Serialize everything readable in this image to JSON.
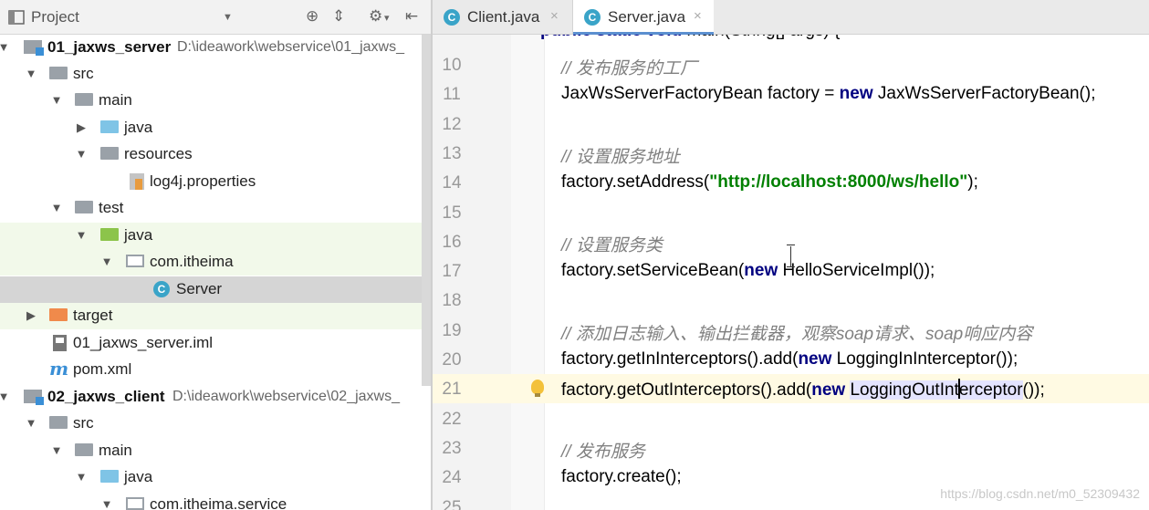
{
  "project_panel": {
    "title": "Project",
    "tree": [
      {
        "label": "01_jaxws_server",
        "path": "D:\\ideawork\\webservice\\01_jaxws_",
        "bold": true
      },
      {
        "label": "src"
      },
      {
        "label": "main"
      },
      {
        "label": "java"
      },
      {
        "label": "resources"
      },
      {
        "label": "log4j.properties"
      },
      {
        "label": "test"
      },
      {
        "label": "java"
      },
      {
        "label": "com.itheima"
      },
      {
        "label": "Server"
      },
      {
        "label": "target"
      },
      {
        "label": "01_jaxws_server.iml"
      },
      {
        "label": "pom.xml"
      },
      {
        "label": "02_jaxws_client",
        "path": "D:\\ideawork\\webservice\\02_jaxws_",
        "bold": true
      },
      {
        "label": "src"
      },
      {
        "label": "main"
      },
      {
        "label": "java"
      },
      {
        "label": "com.itheima.service"
      }
    ]
  },
  "editor": {
    "tabs": [
      {
        "label": "Client.java",
        "close": "×"
      },
      {
        "label": "Server.java",
        "close": "×"
      }
    ],
    "top_partial": "public static void main(String[] args) {",
    "lines": [
      {
        "num": "10",
        "text": "// 发布服务的工厂"
      },
      {
        "num": "11",
        "text": "JaxWsServerFactoryBean factory = new JaxWsServerFactoryBean();"
      },
      {
        "num": "12",
        "text": ""
      },
      {
        "num": "13",
        "text": "// 设置服务地址"
      },
      {
        "num": "14",
        "text": "factory.setAddress(\"http://localhost:8000/ws/hello\");"
      },
      {
        "num": "15",
        "text": ""
      },
      {
        "num": "16",
        "text": "// 设置服务类"
      },
      {
        "num": "17",
        "text": "factory.setServiceBean(new HelloServiceImpl());"
      },
      {
        "num": "18",
        "text": ""
      },
      {
        "num": "19",
        "text": "// 添加日志输入、输出拦截器，观察soap请求、soap响应内容"
      },
      {
        "num": "20",
        "text": "factory.getInInterceptors().add(new LoggingInInterceptor());"
      },
      {
        "num": "21",
        "text": "factory.getOutInterceptors().add(new LoggingOutInterceptor());"
      },
      {
        "num": "22",
        "text": ""
      },
      {
        "num": "23",
        "text": "// 发布服务"
      },
      {
        "num": "24",
        "text": "factory.create();"
      },
      {
        "num": "25",
        "text": ""
      }
    ]
  },
  "watermark": "https://blog.csdn.net/m0_52309432"
}
